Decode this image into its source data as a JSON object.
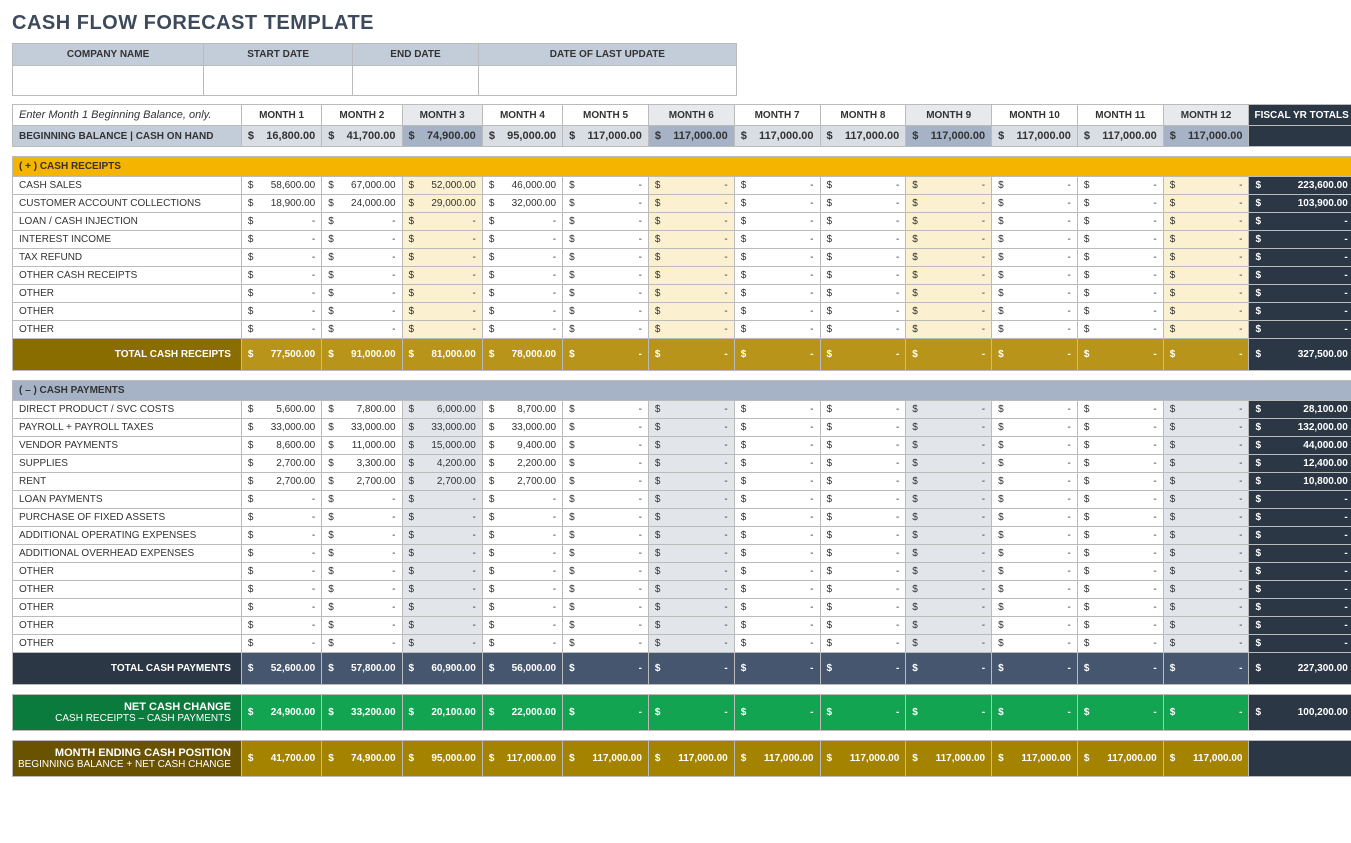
{
  "title": "CASH FLOW FORECAST TEMPLATE",
  "info": {
    "h": [
      "COMPANY NAME",
      "START DATE",
      "END DATE",
      "DATE OF LAST UPDATE"
    ],
    "v": [
      "",
      "",
      "",
      ""
    ]
  },
  "instr": "Enter Month 1 Beginning Balance, only.",
  "months": [
    "MONTH 1",
    "MONTH 2",
    "MONTH 3",
    "MONTH 4",
    "MONTH 5",
    "MONTH 6",
    "MONTH 7",
    "MONTH 8",
    "MONTH 9",
    "MONTH 10",
    "MONTH 11",
    "MONTH 12"
  ],
  "fytLabel": "FISCAL YR TOTALS",
  "bbLabel": "BEGINNING BALANCE | CASH ON HAND",
  "bb": [
    "16,800.00",
    "41,700.00",
    "74,900.00",
    "95,000.00",
    "117,000.00",
    "117,000.00",
    "117,000.00",
    "117,000.00",
    "117,000.00",
    "117,000.00",
    "117,000.00",
    "117,000.00"
  ],
  "sec": {
    "receipts": "( + )   CASH RECEIPTS",
    "payments": "( – )   CASH PAYMENTS"
  },
  "receipts": [
    {
      "l": "CASH SALES",
      "v": [
        "58,600.00",
        "67,000.00",
        "52,000.00",
        "46,000.00",
        "-",
        "-",
        "-",
        "-",
        "-",
        "-",
        "-",
        "-"
      ],
      "t": "223,600.00"
    },
    {
      "l": "CUSTOMER ACCOUNT COLLECTIONS",
      "v": [
        "18,900.00",
        "24,000.00",
        "29,000.00",
        "32,000.00",
        "-",
        "-",
        "-",
        "-",
        "-",
        "-",
        "-",
        "-"
      ],
      "t": "103,900.00"
    },
    {
      "l": "LOAN / CASH INJECTION",
      "v": [
        "-",
        "-",
        "-",
        "-",
        "-",
        "-",
        "-",
        "-",
        "-",
        "-",
        "-",
        "-"
      ],
      "t": "-"
    },
    {
      "l": "INTEREST INCOME",
      "v": [
        "-",
        "-",
        "-",
        "-",
        "-",
        "-",
        "-",
        "-",
        "-",
        "-",
        "-",
        "-"
      ],
      "t": "-"
    },
    {
      "l": "TAX REFUND",
      "v": [
        "-",
        "-",
        "-",
        "-",
        "-",
        "-",
        "-",
        "-",
        "-",
        "-",
        "-",
        "-"
      ],
      "t": "-"
    },
    {
      "l": "OTHER CASH RECEIPTS",
      "v": [
        "-",
        "-",
        "-",
        "-",
        "-",
        "-",
        "-",
        "-",
        "-",
        "-",
        "-",
        "-"
      ],
      "t": "-"
    },
    {
      "l": "OTHER",
      "v": [
        "-",
        "-",
        "-",
        "-",
        "-",
        "-",
        "-",
        "-",
        "-",
        "-",
        "-",
        "-"
      ],
      "t": "-"
    },
    {
      "l": "OTHER",
      "v": [
        "-",
        "-",
        "-",
        "-",
        "-",
        "-",
        "-",
        "-",
        "-",
        "-",
        "-",
        "-"
      ],
      "t": "-"
    },
    {
      "l": "OTHER",
      "v": [
        "-",
        "-",
        "-",
        "-",
        "-",
        "-",
        "-",
        "-",
        "-",
        "-",
        "-",
        "-"
      ],
      "t": "-"
    }
  ],
  "totR": {
    "l": "TOTAL CASH RECEIPTS",
    "v": [
      "77,500.00",
      "91,000.00",
      "81,000.00",
      "78,000.00",
      "-",
      "-",
      "-",
      "-",
      "-",
      "-",
      "-",
      "-"
    ],
    "t": "327,500.00"
  },
  "payments": [
    {
      "l": "DIRECT PRODUCT / SVC COSTS",
      "v": [
        "5,600.00",
        "7,800.00",
        "6,000.00",
        "8,700.00",
        "-",
        "-",
        "-",
        "-",
        "-",
        "-",
        "-",
        "-"
      ],
      "t": "28,100.00"
    },
    {
      "l": "PAYROLL + PAYROLL TAXES",
      "v": [
        "33,000.00",
        "33,000.00",
        "33,000.00",
        "33,000.00",
        "-",
        "-",
        "-",
        "-",
        "-",
        "-",
        "-",
        "-"
      ],
      "t": "132,000.00"
    },
    {
      "l": "VENDOR PAYMENTS",
      "v": [
        "8,600.00",
        "11,000.00",
        "15,000.00",
        "9,400.00",
        "-",
        "-",
        "-",
        "-",
        "-",
        "-",
        "-",
        "-"
      ],
      "t": "44,000.00"
    },
    {
      "l": "SUPPLIES",
      "v": [
        "2,700.00",
        "3,300.00",
        "4,200.00",
        "2,200.00",
        "-",
        "-",
        "-",
        "-",
        "-",
        "-",
        "-",
        "-"
      ],
      "t": "12,400.00"
    },
    {
      "l": "RENT",
      "v": [
        "2,700.00",
        "2,700.00",
        "2,700.00",
        "2,700.00",
        "-",
        "-",
        "-",
        "-",
        "-",
        "-",
        "-",
        "-"
      ],
      "t": "10,800.00"
    },
    {
      "l": "LOAN PAYMENTS",
      "v": [
        "-",
        "-",
        "-",
        "-",
        "-",
        "-",
        "-",
        "-",
        "-",
        "-",
        "-",
        "-"
      ],
      "t": "-"
    },
    {
      "l": "PURCHASE OF FIXED ASSETS",
      "v": [
        "-",
        "-",
        "-",
        "-",
        "-",
        "-",
        "-",
        "-",
        "-",
        "-",
        "-",
        "-"
      ],
      "t": "-"
    },
    {
      "l": "ADDITIONAL OPERATING EXPENSES",
      "v": [
        "-",
        "-",
        "-",
        "-",
        "-",
        "-",
        "-",
        "-",
        "-",
        "-",
        "-",
        "-"
      ],
      "t": "-"
    },
    {
      "l": "ADDITIONAL OVERHEAD EXPENSES",
      "v": [
        "-",
        "-",
        "-",
        "-",
        "-",
        "-",
        "-",
        "-",
        "-",
        "-",
        "-",
        "-"
      ],
      "t": "-"
    },
    {
      "l": "OTHER",
      "v": [
        "-",
        "-",
        "-",
        "-",
        "-",
        "-",
        "-",
        "-",
        "-",
        "-",
        "-",
        "-"
      ],
      "t": "-"
    },
    {
      "l": "OTHER",
      "v": [
        "-",
        "-",
        "-",
        "-",
        "-",
        "-",
        "-",
        "-",
        "-",
        "-",
        "-",
        "-"
      ],
      "t": "-"
    },
    {
      "l": "OTHER",
      "v": [
        "-",
        "-",
        "-",
        "-",
        "-",
        "-",
        "-",
        "-",
        "-",
        "-",
        "-",
        "-"
      ],
      "t": "-"
    },
    {
      "l": "OTHER",
      "v": [
        "-",
        "-",
        "-",
        "-",
        "-",
        "-",
        "-",
        "-",
        "-",
        "-",
        "-",
        "-"
      ],
      "t": "-"
    },
    {
      "l": "OTHER",
      "v": [
        "-",
        "-",
        "-",
        "-",
        "-",
        "-",
        "-",
        "-",
        "-",
        "-",
        "-",
        "-"
      ],
      "t": "-"
    }
  ],
  "totP": {
    "l": "TOTAL CASH PAYMENTS",
    "v": [
      "52,600.00",
      "57,800.00",
      "60,900.00",
      "56,000.00",
      "-",
      "-",
      "-",
      "-",
      "-",
      "-",
      "-",
      "-"
    ],
    "t": "227,300.00"
  },
  "net": {
    "l1": "NET CASH CHANGE",
    "l2": "CASH RECEIPTS – CASH PAYMENTS",
    "v": [
      "24,900.00",
      "33,200.00",
      "20,100.00",
      "22,000.00",
      "-",
      "-",
      "-",
      "-",
      "-",
      "-",
      "-",
      "-"
    ],
    "t": "100,200.00"
  },
  "pos": {
    "l1": "MONTH ENDING CASH POSITION",
    "l2": "BEGINNING BALANCE + NET CASH CHANGE",
    "v": [
      "41,700.00",
      "74,900.00",
      "95,000.00",
      "117,000.00",
      "117,000.00",
      "117,000.00",
      "117,000.00",
      "117,000.00",
      "117,000.00",
      "117,000.00",
      "117,000.00",
      "117,000.00"
    ],
    "t": ""
  }
}
